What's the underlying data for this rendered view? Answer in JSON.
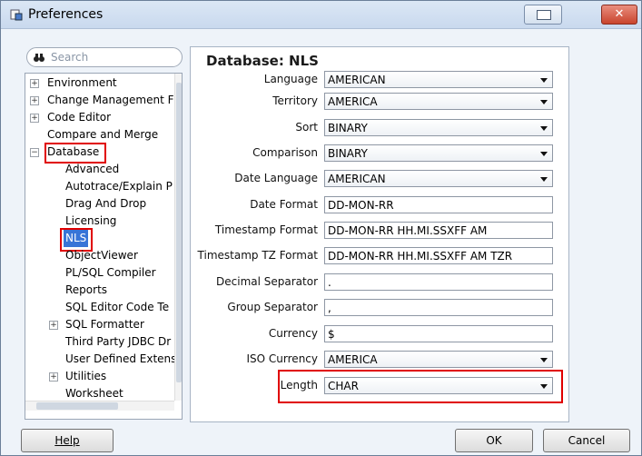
{
  "window": {
    "title": "Preferences"
  },
  "search": {
    "placeholder": "Search"
  },
  "tree": {
    "items": [
      {
        "label": "Environment",
        "expandable": "⊞"
      },
      {
        "label": "Change Management F",
        "expandable": "⊞"
      },
      {
        "label": "Code Editor",
        "expandable": "⊞"
      },
      {
        "label": "Compare and Merge",
        "expandable": ""
      },
      {
        "label": "Database",
        "expandable": "⊟"
      },
      {
        "label": "Advanced",
        "expandable": ""
      },
      {
        "label": "Autotrace/Explain P",
        "expandable": ""
      },
      {
        "label": "Drag And Drop",
        "expandable": ""
      },
      {
        "label": "Licensing",
        "expandable": ""
      },
      {
        "label": "NLS",
        "expandable": ""
      },
      {
        "label": "ObjectViewer",
        "expandable": ""
      },
      {
        "label": "PL/SQL Compiler",
        "expandable": ""
      },
      {
        "label": "Reports",
        "expandable": ""
      },
      {
        "label": "SQL Editor Code Te",
        "expandable": ""
      },
      {
        "label": "SQL Formatter",
        "expandable": "⊞"
      },
      {
        "label": "Third Party JDBC Dr",
        "expandable": ""
      },
      {
        "label": "User Defined Extens",
        "expandable": ""
      },
      {
        "label": "Utilities",
        "expandable": "⊞"
      },
      {
        "label": "Worksheet",
        "expandable": ""
      }
    ]
  },
  "panel": {
    "title": "Database: NLS",
    "fields": [
      {
        "label": "Language",
        "value": "AMERICAN"
      },
      {
        "label": "Territory",
        "value": "AMERICA"
      },
      {
        "label": "Sort",
        "value": "BINARY"
      },
      {
        "label": "Comparison",
        "value": "BINARY"
      },
      {
        "label": "Date Language",
        "value": "AMERICAN"
      },
      {
        "label": "Date Format",
        "value": "DD-MON-RR"
      },
      {
        "label": "Timestamp Format",
        "value": "DD-MON-RR HH.MI.SSXFF AM"
      },
      {
        "label": "Timestamp TZ Format",
        "value": "DD-MON-RR HH.MI.SSXFF AM TZR"
      },
      {
        "label": "Decimal Separator",
        "value": "."
      },
      {
        "label": "Group Separator",
        "value": ","
      },
      {
        "label": "Currency",
        "value": "$"
      },
      {
        "label": "ISO Currency",
        "value": "AMERICA"
      },
      {
        "label": "Length",
        "value": "CHAR"
      }
    ]
  },
  "buttons": {
    "help": "Help",
    "ok": "OK",
    "cancel": "Cancel"
  },
  "colors": {
    "highlight": "#e00000",
    "selection": "#3875d7"
  }
}
